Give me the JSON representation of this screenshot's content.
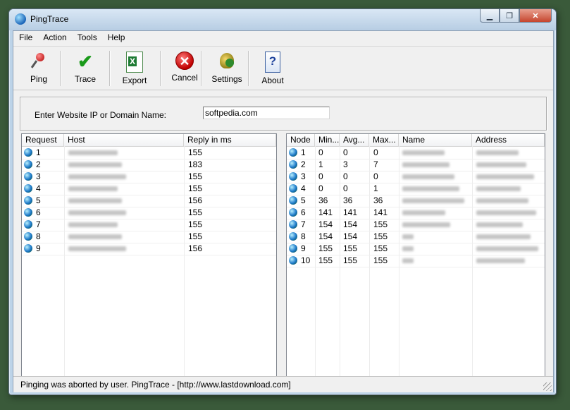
{
  "window": {
    "title": "PingTrace",
    "buttons": {
      "minimize": "▁",
      "maximize": "❐",
      "close": "✕"
    }
  },
  "menu": [
    "File",
    "Action",
    "Tools",
    "Help"
  ],
  "toolbar": {
    "ping": "Ping",
    "trace": "Trace",
    "export": "Export",
    "cancel": "Cancel",
    "settings": "Settings",
    "about": "About"
  },
  "input": {
    "label": "Enter Website IP or Domain Name:",
    "value": "softpedia.com"
  },
  "ping_table": {
    "columns": [
      "Request",
      "Host",
      "Reply in ms"
    ],
    "rows": [
      {
        "request": "1",
        "reply": "155"
      },
      {
        "request": "2",
        "reply": "183"
      },
      {
        "request": "3",
        "reply": "155"
      },
      {
        "request": "4",
        "reply": "155"
      },
      {
        "request": "5",
        "reply": "156"
      },
      {
        "request": "6",
        "reply": "155"
      },
      {
        "request": "7",
        "reply": "155"
      },
      {
        "request": "8",
        "reply": "155"
      },
      {
        "request": "9",
        "reply": "156"
      }
    ]
  },
  "trace_table": {
    "columns": [
      "Node",
      "Min...",
      "Avg...",
      "Max...",
      "Name",
      "Address"
    ],
    "rows": [
      {
        "node": "1",
        "min": "0",
        "avg": "0",
        "max": "0"
      },
      {
        "node": "2",
        "min": "1",
        "avg": "3",
        "max": "7"
      },
      {
        "node": "3",
        "min": "0",
        "avg": "0",
        "max": "0"
      },
      {
        "node": "4",
        "min": "0",
        "avg": "0",
        "max": "1"
      },
      {
        "node": "5",
        "min": "36",
        "avg": "36",
        "max": "36"
      },
      {
        "node": "6",
        "min": "141",
        "avg": "141",
        "max": "141"
      },
      {
        "node": "7",
        "min": "154",
        "avg": "154",
        "max": "155"
      },
      {
        "node": "8",
        "min": "154",
        "avg": "154",
        "max": "155"
      },
      {
        "node": "9",
        "min": "155",
        "avg": "155",
        "max": "155"
      },
      {
        "node": "10",
        "min": "155",
        "avg": "155",
        "max": "155"
      }
    ]
  },
  "status": "Pinging was aborted by user. PingTrace - [http://www.lastdownload.com]"
}
